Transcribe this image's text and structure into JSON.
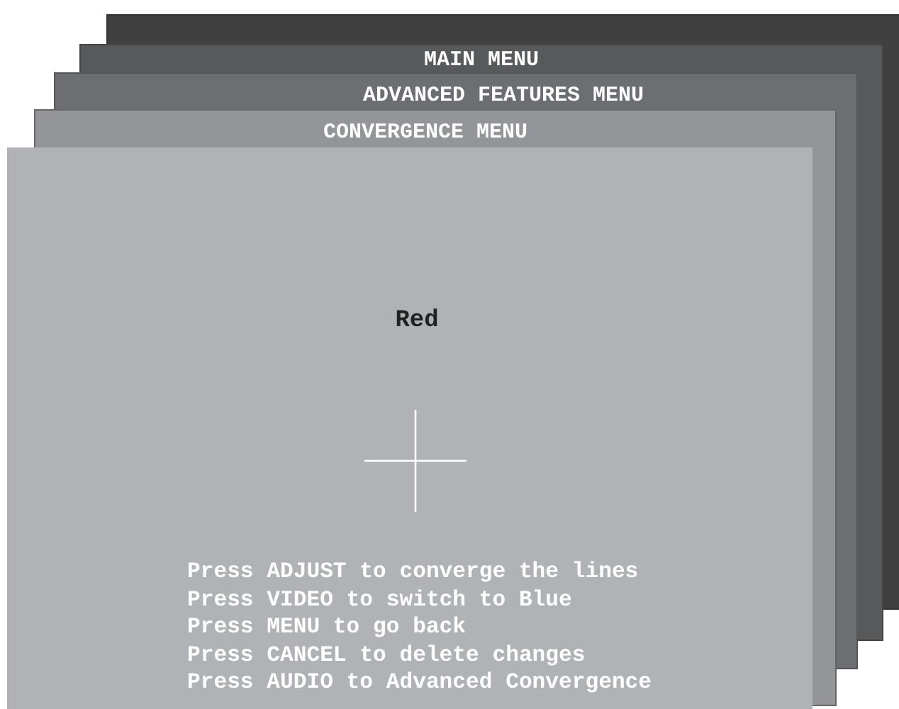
{
  "menus": [
    {
      "title": "MAIN MENU"
    },
    {
      "title": "ADVANCED FEATURES MENU"
    },
    {
      "title": "CONVERGENCE MENU"
    }
  ],
  "screen": {
    "heading": "Red",
    "instructions": [
      "Press ADJUST to converge the lines",
      "Press VIDEO to switch to Blue",
      "Press MENU to go back",
      "Press CANCEL to delete changes",
      "Press AUDIO to Advanced Convergence"
    ]
  }
}
